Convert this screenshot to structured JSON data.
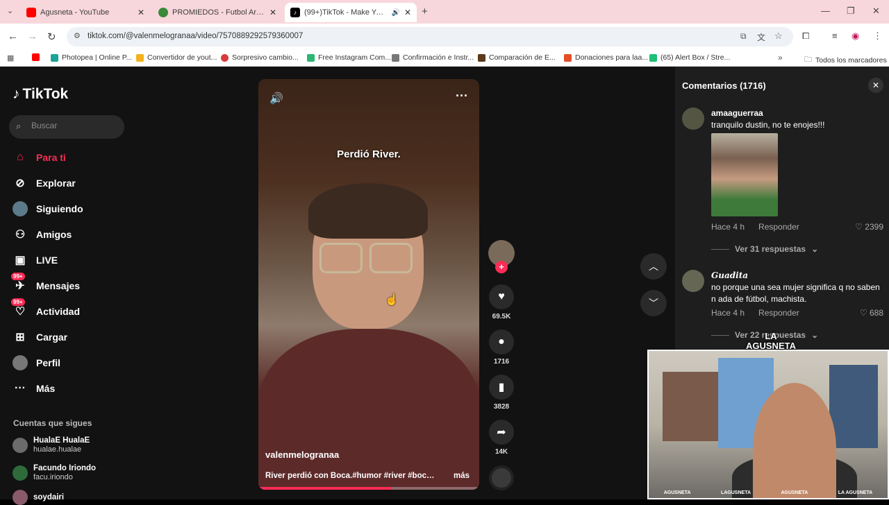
{
  "browser": {
    "tabs": [
      {
        "title": "Agusneta - YouTube",
        "favicon_color": "#ff0000"
      },
      {
        "title": "PROMIEDOS - Futbol Argentino",
        "favicon_color": "#3a8a3a"
      },
      {
        "title": "(99+)TikTok - Make Your Day",
        "favicon_color": "#000000"
      }
    ],
    "new_tab": "+",
    "url": "tiktok.com/@valenmelogranaa/video/7570889292579360007",
    "bookmarks": [
      {
        "label": "",
        "color": "#ff0000"
      },
      {
        "label": "Photopea | Online P...",
        "color": "#18a497"
      },
      {
        "label": "Convertidor de yout...",
        "color": "#f3b21b"
      },
      {
        "label": "Sorpresivo cambio...",
        "color": "#d83b3b"
      },
      {
        "label": "Free Instagram Com...",
        "color": "#2bb673"
      },
      {
        "label": "Confirmación e Instr...",
        "color": "#777777"
      },
      {
        "label": "Comparación de E...",
        "color": "#5a3a1a"
      },
      {
        "label": "Donaciones para laa...",
        "color": "#e44d26"
      },
      {
        "label": "(65) Alert Box / Stre...",
        "color": "#1dbf73"
      }
    ],
    "all_bookmarks": "Todos los marcadores"
  },
  "tiktok": {
    "logo": "TikTok",
    "search_placeholder": "Buscar",
    "nav": [
      {
        "label": "Para ti",
        "icon": "home-icon"
      },
      {
        "label": "Explorar",
        "icon": "compass-icon"
      },
      {
        "label": "Siguiendo",
        "icon": "following-avatar-icon"
      },
      {
        "label": "Amigos",
        "icon": "friends-icon"
      },
      {
        "label": "LIVE",
        "icon": "live-icon"
      },
      {
        "label": "Mensajes",
        "icon": "messages-icon",
        "badge": "99+"
      },
      {
        "label": "Actividad",
        "icon": "activity-icon",
        "badge": "99+"
      },
      {
        "label": "Cargar",
        "icon": "upload-icon"
      },
      {
        "label": "Perfil",
        "icon": "profile-icon"
      },
      {
        "label": "Más",
        "icon": "more-icon"
      }
    ],
    "following_title": "Cuentas que sigues",
    "following": [
      {
        "name": "HualaE HualaE",
        "username": "hualae.hualae"
      },
      {
        "name": "Facundo Iriondo",
        "username": "facu.iriondo"
      },
      {
        "name": "soydairi",
        "username": ""
      }
    ],
    "video": {
      "caption_overlay": "Perdió River.",
      "author": "valenmelogranaa",
      "description": "River perdió con Boca.#humor #river #boca ...",
      "more": "más",
      "progress": 0.6
    },
    "actions": {
      "likes": "69.5K",
      "comments": "1716",
      "saves": "3828",
      "shares": "14K"
    },
    "comments_panel": {
      "title": "Comentarios (1716)",
      "comments": [
        {
          "user": "amaaguerraa",
          "text": "tranquilo dustin, no te enojes!!!",
          "time": "Hace 4 h",
          "reply": "Responder",
          "likes": "2399",
          "replies": "Ver 31 respuestas"
        },
        {
          "user": "Guadita",
          "text": "no porque una sea mujer significa q no saben n ada de fútbol, machista.",
          "time": "Hace 4 h",
          "reply": "Responder",
          "likes": "688",
          "replies": "Ver 22 respuestas"
        }
      ]
    }
  },
  "webcam": {
    "logo_line1": "LA",
    "logo_line2": "AGUSNETA",
    "socials": [
      "AGUSNETA",
      "LAGUSNETA",
      "AGUSNETA",
      "LA AGUSNETA"
    ]
  }
}
